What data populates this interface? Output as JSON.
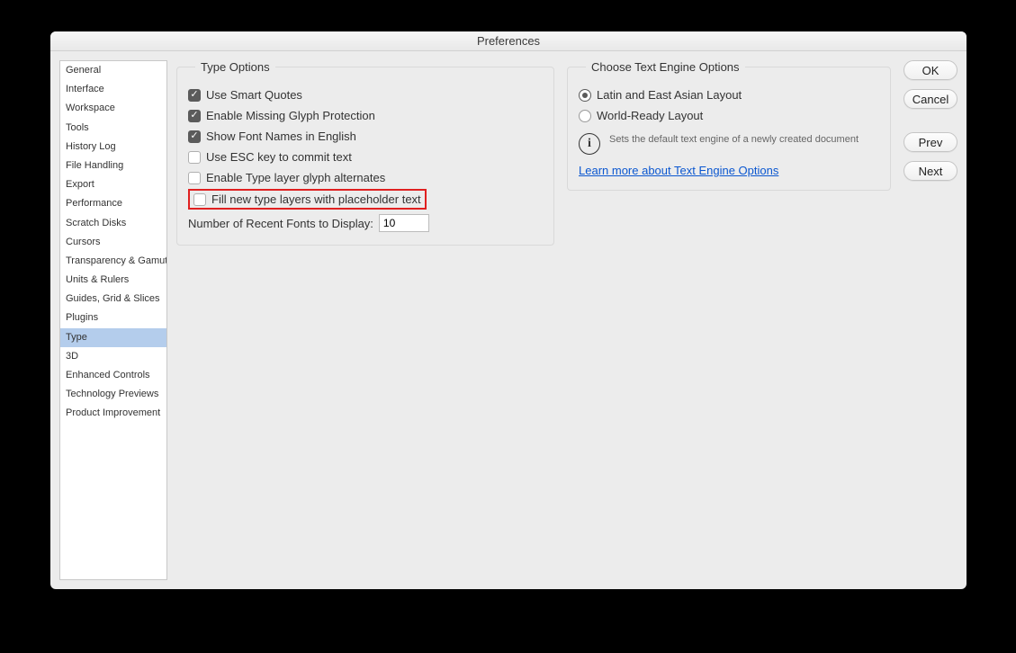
{
  "window": {
    "title": "Preferences"
  },
  "sidebar": {
    "items": [
      {
        "label": "General"
      },
      {
        "label": "Interface"
      },
      {
        "label": "Workspace"
      },
      {
        "label": "Tools"
      },
      {
        "label": "History Log"
      },
      {
        "label": "File Handling"
      },
      {
        "label": "Export"
      },
      {
        "label": "Performance"
      },
      {
        "label": "Scratch Disks"
      },
      {
        "label": "Cursors"
      },
      {
        "label": "Transparency & Gamut"
      },
      {
        "label": "Units & Rulers"
      },
      {
        "label": "Guides, Grid & Slices"
      },
      {
        "label": "Plugins"
      },
      {
        "label": "Type",
        "selected": true
      },
      {
        "label": "3D"
      },
      {
        "label": "Enhanced Controls"
      },
      {
        "label": "Technology Previews"
      },
      {
        "label": "Product Improvement"
      }
    ]
  },
  "typeOptions": {
    "legend": "Type Options",
    "useSmartQuotes": "Use Smart Quotes",
    "enableMissingGlyph": "Enable Missing Glyph Protection",
    "showFontNamesEnglish": "Show Font Names in English",
    "useEscKey": "Use ESC key to commit text",
    "enableGlyphAlternates": "Enable Type layer glyph alternates",
    "fillPlaceholder": "Fill new type layers with placeholder text",
    "recentFontsLabel": "Number of Recent Fonts to Display:",
    "recentFontsValue": "10"
  },
  "engineOptions": {
    "legend": "Choose Text Engine Options",
    "latinEastAsian": "Latin and East Asian Layout",
    "worldReady": "World-Ready Layout",
    "infoText": "Sets the default text engine of a newly created document",
    "learnMore": "Learn more about Text Engine Options"
  },
  "actions": {
    "ok": "OK",
    "cancel": "Cancel",
    "prev": "Prev",
    "next": "Next"
  }
}
